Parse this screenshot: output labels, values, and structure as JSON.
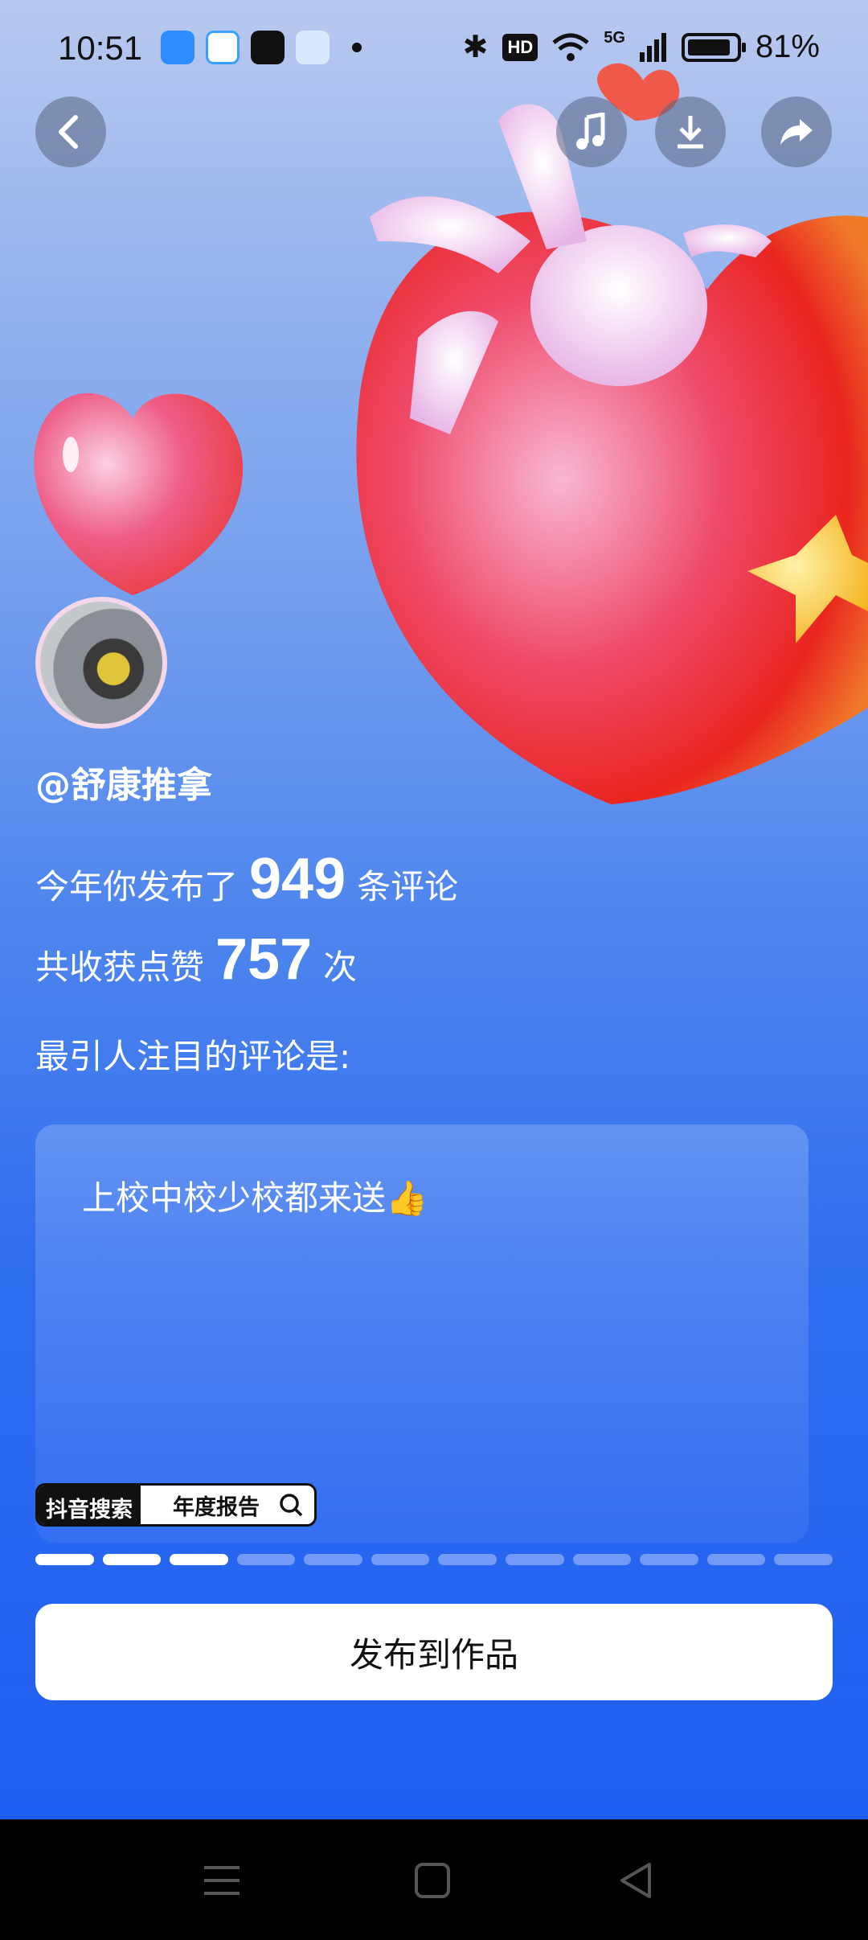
{
  "status_bar": {
    "time": "10:51",
    "network": "5G",
    "hd_label": "HD",
    "battery": "81%"
  },
  "profile": {
    "username": "@舒康推拿"
  },
  "stats": {
    "comments_prefix": "今年你发布了",
    "comments_count": "949",
    "comments_suffix": "条评论",
    "likes_prefix": "共收获点赞",
    "likes_count": "757",
    "likes_suffix": "次",
    "highlight_label": "最引人注目的评论是:"
  },
  "comment": {
    "text": "上校中校少校都来送👍"
  },
  "search_pill": {
    "left_label": "抖音搜索",
    "right_label": "年度报告"
  },
  "progress": {
    "total_segments": 12,
    "completed_segments": 3
  },
  "actions": {
    "publish_label": "发布到作品"
  },
  "colors": {
    "accent_blue": "#2f6def",
    "heart_red": "#ee3b3b",
    "heart_pink": "#f7a3c6"
  }
}
